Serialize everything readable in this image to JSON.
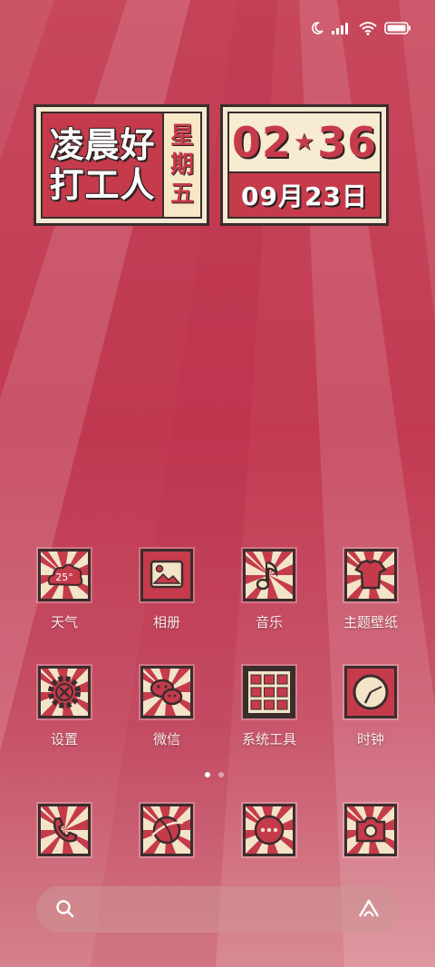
{
  "status_bar": {
    "icons": [
      "moon-icon",
      "signal-icon",
      "wifi-icon",
      "battery-icon"
    ]
  },
  "widget": {
    "greeting_line1": "凌晨好",
    "greeting_line2": "打工人",
    "weekday_chars": [
      "星",
      "期",
      "五"
    ],
    "time_hour": "02",
    "time_minute": "36",
    "time_separator": "★",
    "date": "09月23日"
  },
  "apps": [
    {
      "label": "天气",
      "icon": "weather-icon",
      "temp": "25°"
    },
    {
      "label": "相册",
      "icon": "gallery-icon"
    },
    {
      "label": "音乐",
      "icon": "music-icon"
    },
    {
      "label": "主题壁纸",
      "icon": "theme-icon"
    },
    {
      "label": "设置",
      "icon": "settings-icon"
    },
    {
      "label": "微信",
      "icon": "wechat-icon"
    },
    {
      "label": "系统工具",
      "icon": "tools-folder-icon"
    },
    {
      "label": "时钟",
      "icon": "clock-icon"
    }
  ],
  "dock": [
    {
      "icon": "phone-icon"
    },
    {
      "icon": "browser-icon"
    },
    {
      "icon": "messages-icon"
    },
    {
      "icon": "camera-icon"
    }
  ],
  "page_indicator": {
    "count": 2,
    "active": 0
  },
  "search": {
    "icons": [
      "search-icon",
      "assistant-icon"
    ]
  },
  "colors": {
    "primary_red": "#c53b4c",
    "cream": "#f3ead2",
    "outline": "#3a2d2c"
  }
}
